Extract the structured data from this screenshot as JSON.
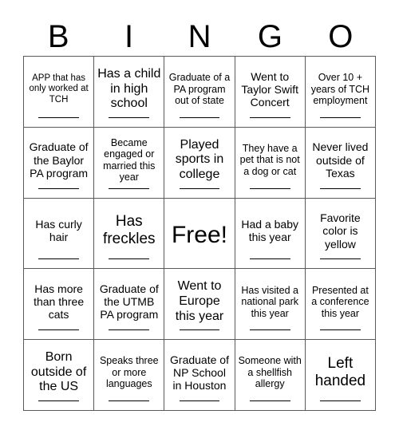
{
  "header": {
    "letters": [
      "B",
      "I",
      "N",
      "G",
      "O"
    ]
  },
  "grid": {
    "rows": 5,
    "columns": 5,
    "border_color": "#5a5a5a",
    "background_color": "#ffffff",
    "text_color": "#000000",
    "cells": [
      {
        "text": "APP that has only worked at TCH",
        "size": "xs",
        "has_line": true
      },
      {
        "text": "Has a child in high school",
        "size": "l",
        "has_line": true
      },
      {
        "text": "Graduate of a PA program out of state",
        "size": "s",
        "has_line": true
      },
      {
        "text": "Went to Taylor Swift Concert",
        "size": "m",
        "has_line": true
      },
      {
        "text": "Over 10 + years of TCH employment",
        "size": "s",
        "has_line": true
      },
      {
        "text": "Graduate of the Baylor PA program",
        "size": "m",
        "has_line": true
      },
      {
        "text": "Became engaged or married this year",
        "size": "s",
        "has_line": true
      },
      {
        "text": "Played sports in college",
        "size": "l",
        "has_line": true
      },
      {
        "text": "They have a pet that is not a dog or cat",
        "size": "s",
        "has_line": true
      },
      {
        "text": "Never lived outside of Texas",
        "size": "m",
        "has_line": true
      },
      {
        "text": "Has curly hair",
        "size": "m",
        "has_line": true
      },
      {
        "text": "Has freckles",
        "size": "xl",
        "has_line": true
      },
      {
        "text": "Free!",
        "size": "free",
        "has_line": false
      },
      {
        "text": "Had a baby this year",
        "size": "m",
        "has_line": true
      },
      {
        "text": "Favorite color is yellow",
        "size": "m",
        "has_line": true
      },
      {
        "text": "Has more than three cats",
        "size": "m",
        "has_line": true
      },
      {
        "text": "Graduate of the UTMB PA program",
        "size": "m",
        "has_line": true
      },
      {
        "text": "Went to Europe this year",
        "size": "l",
        "has_line": true
      },
      {
        "text": "Has visited a national park this year",
        "size": "s",
        "has_line": true
      },
      {
        "text": "Presented at a conference this year",
        "size": "s",
        "has_line": true
      },
      {
        "text": "Born outside of the US",
        "size": "l",
        "has_line": true
      },
      {
        "text": "Speaks three or more languages",
        "size": "s",
        "has_line": true
      },
      {
        "text": "Graduate of NP School in Houston",
        "size": "m",
        "has_line": true
      },
      {
        "text": "Someone with a shellfish allergy",
        "size": "s",
        "has_line": true
      },
      {
        "text": "Left handed",
        "size": "xl",
        "has_line": true
      }
    ]
  }
}
